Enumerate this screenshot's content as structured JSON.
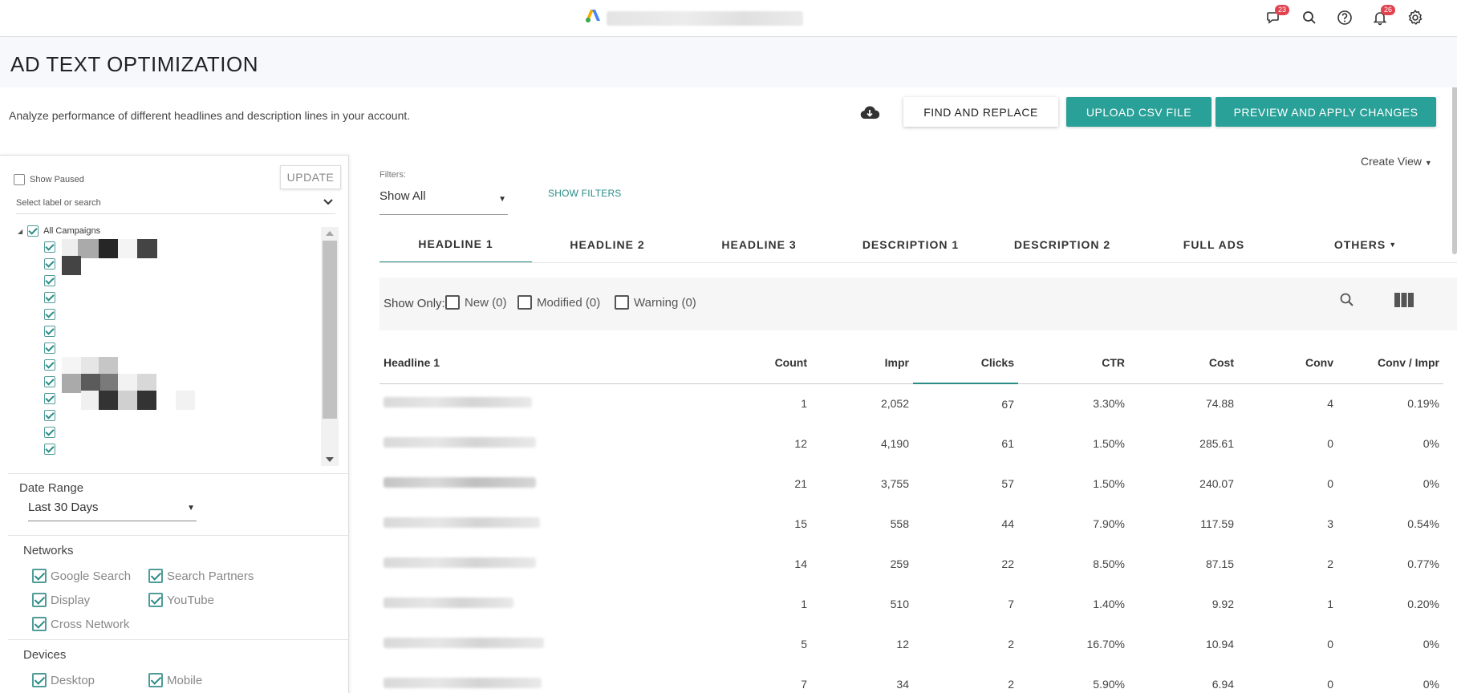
{
  "header": {
    "account_name": "",
    "notifications_badge_left": "23",
    "notifications_badge_right": "26"
  },
  "page": {
    "title": "AD TEXT OPTIMIZATION",
    "subtitle": "Analyze performance of different headlines and description lines in your account."
  },
  "actions": {
    "find_replace": "FIND AND REPLACE",
    "upload_csv": "UPLOAD CSV FILE",
    "preview_apply": "PREVIEW AND APPLY CHANGES"
  },
  "sidebar": {
    "show_paused": "Show Paused",
    "update": "UPDATE",
    "label_search_placeholder": "Select label or search",
    "all_campaigns": "All Campaigns",
    "date_range_label": "Date Range",
    "date_range_value": "Last 30 Days",
    "networks_label": "Networks",
    "networks": [
      "Google Search",
      "Search Partners",
      "Display",
      "YouTube",
      "Cross Network"
    ],
    "devices_label": "Devices",
    "devices": [
      "Desktop",
      "Mobile"
    ]
  },
  "filters": {
    "label": "Filters:",
    "value": "Show All",
    "show_filters": "SHOW FILTERS",
    "create_view": "Create View"
  },
  "tabs": [
    "HEADLINE 1",
    "HEADLINE 2",
    "HEADLINE 3",
    "DESCRIPTION 1",
    "DESCRIPTION 2",
    "FULL ADS",
    "OTHERS"
  ],
  "active_tab": "HEADLINE 1",
  "show_only": {
    "label": "Show Only:",
    "options": [
      "New (0)",
      "Modified (0)",
      "Warning (0)"
    ]
  },
  "table": {
    "columns": [
      "Headline 1",
      "Count",
      "Impr",
      "Clicks",
      "CTR",
      "Cost",
      "Conv",
      "Conv / Impr"
    ],
    "sorted_column": "Clicks",
    "rows": [
      {
        "count": "1",
        "impr": "2,052",
        "clicks": "67",
        "ctr": "3.30%",
        "cost": "74.88",
        "conv": "4",
        "conv_impr": "0.19%"
      },
      {
        "count": "12",
        "impr": "4,190",
        "clicks": "61",
        "ctr": "1.50%",
        "cost": "285.61",
        "conv": "0",
        "conv_impr": "0%"
      },
      {
        "count": "21",
        "impr": "3,755",
        "clicks": "57",
        "ctr": "1.50%",
        "cost": "240.07",
        "conv": "0",
        "conv_impr": "0%"
      },
      {
        "count": "15",
        "impr": "558",
        "clicks": "44",
        "ctr": "7.90%",
        "cost": "117.59",
        "conv": "3",
        "conv_impr": "0.54%"
      },
      {
        "count": "14",
        "impr": "259",
        "clicks": "22",
        "ctr": "8.50%",
        "cost": "87.15",
        "conv": "2",
        "conv_impr": "0.77%"
      },
      {
        "count": "1",
        "impr": "510",
        "clicks": "7",
        "ctr": "1.40%",
        "cost": "9.92",
        "conv": "1",
        "conv_impr": "0.20%"
      },
      {
        "count": "5",
        "impr": "12",
        "clicks": "2",
        "ctr": "16.70%",
        "cost": "10.94",
        "conv": "0",
        "conv_impr": "0%"
      },
      {
        "count": "7",
        "impr": "34",
        "clicks": "2",
        "ctr": "5.90%",
        "cost": "6.94",
        "conv": "0",
        "conv_impr": "0%"
      }
    ]
  },
  "colors": {
    "accent": "#2aa198",
    "accent_dark": "#2a8c86",
    "badge": "#e0424e"
  },
  "icons": [
    "google-ads-logo-icon",
    "chat-icon",
    "search-icon",
    "help-icon",
    "bell-icon",
    "gear-icon",
    "cloud-download-icon",
    "columns-icon",
    "chevron-down-icon"
  ]
}
